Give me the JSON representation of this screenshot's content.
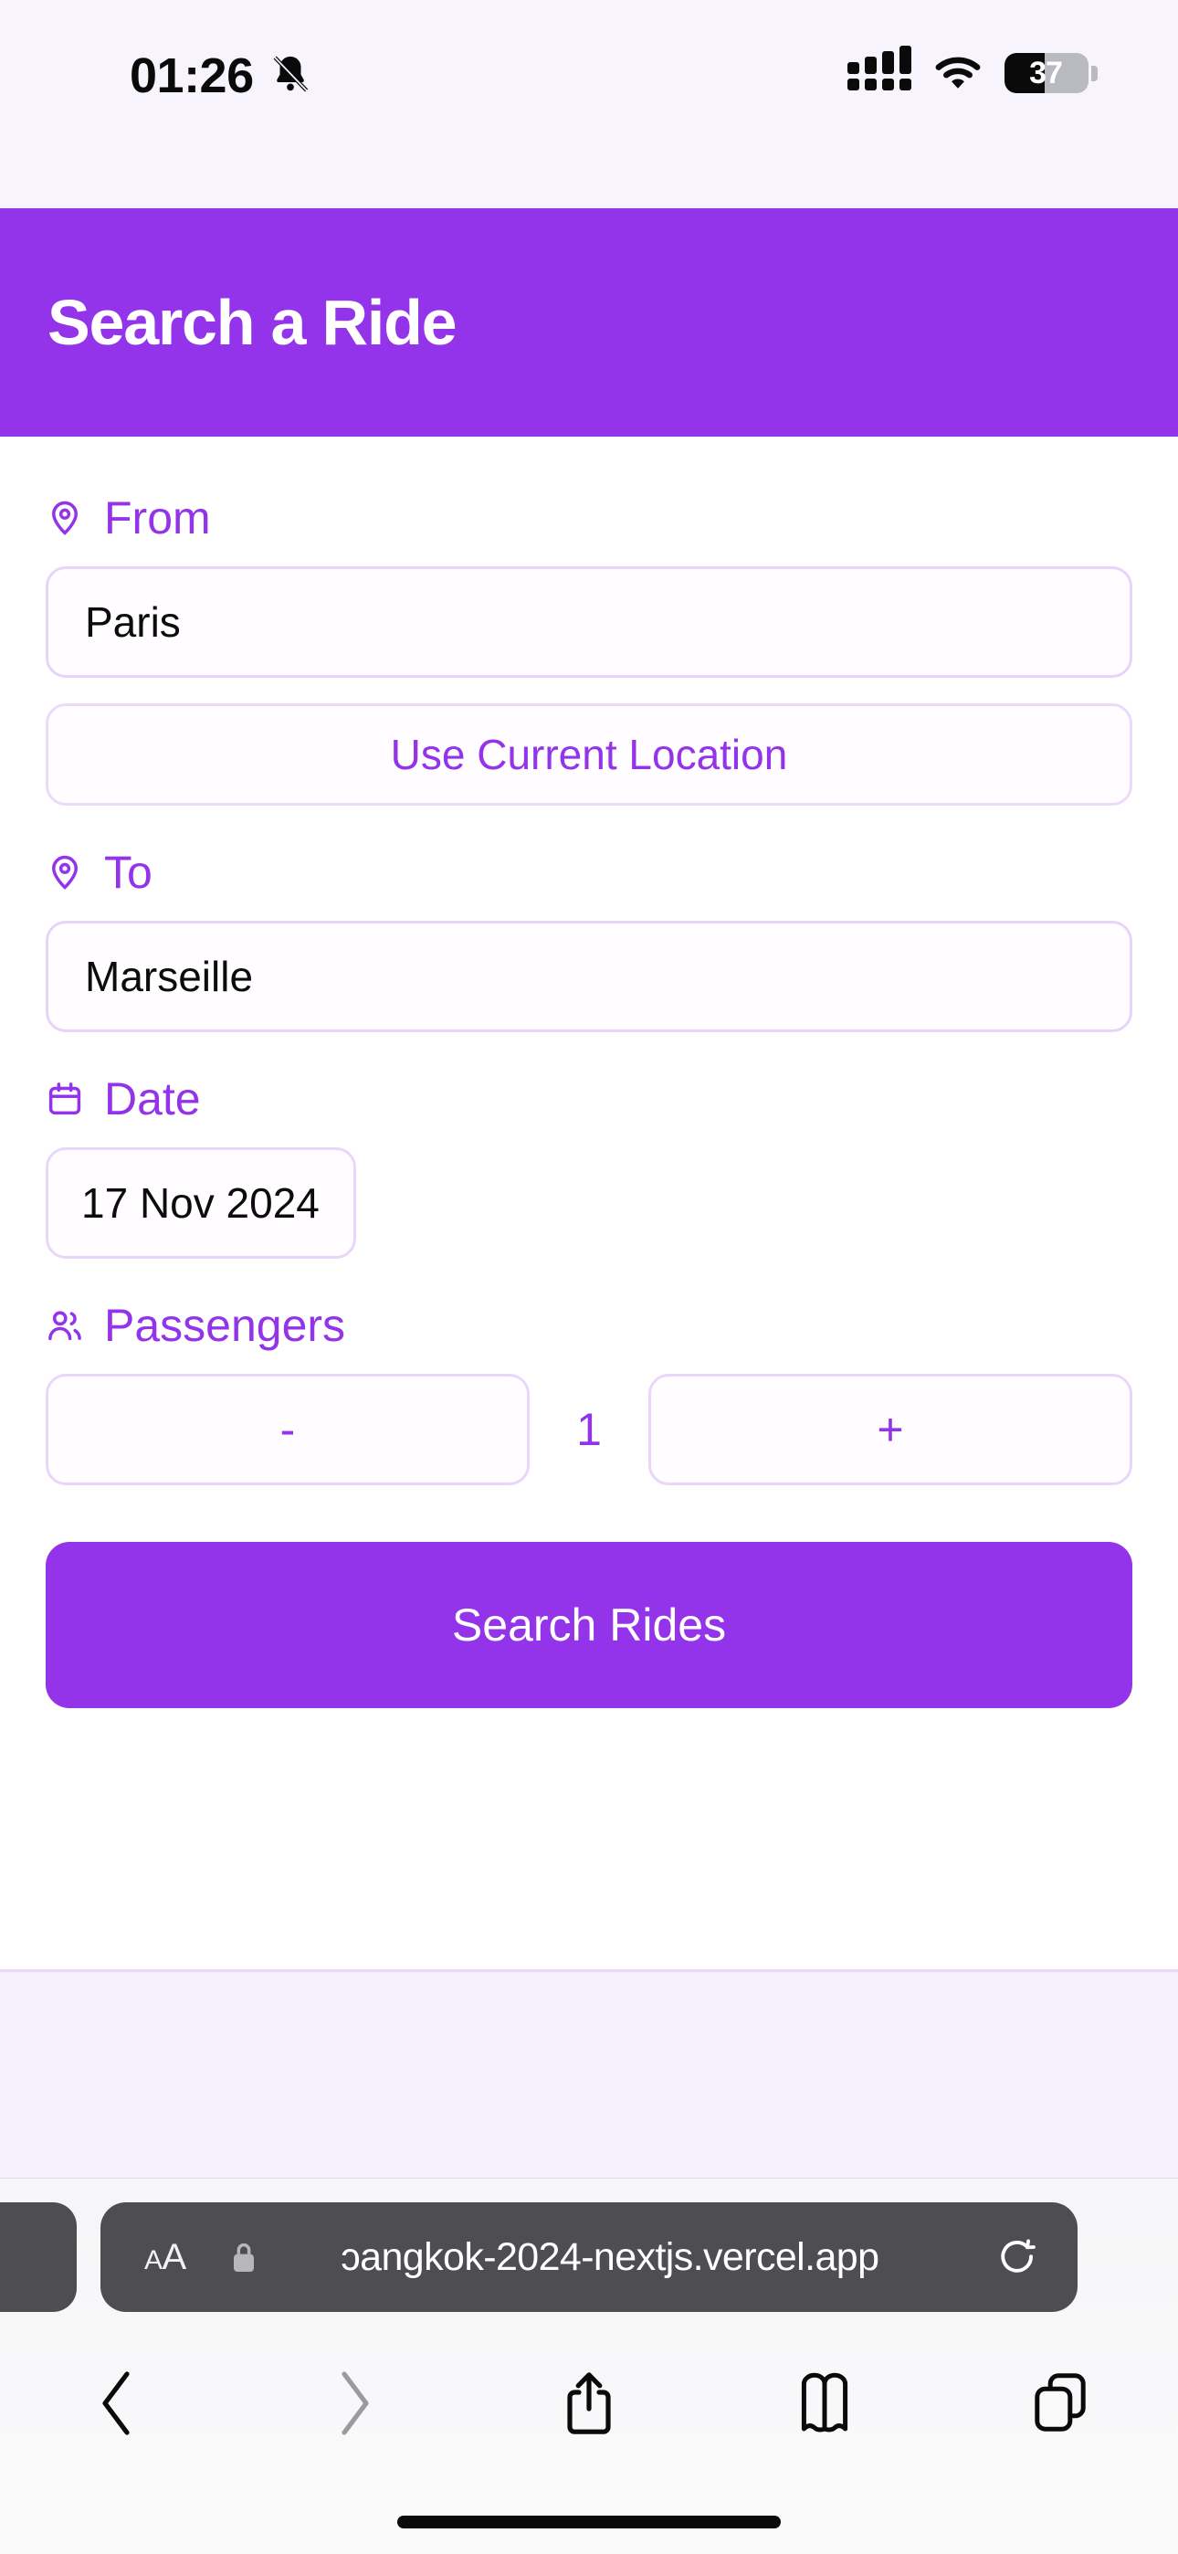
{
  "status_bar": {
    "time": "01:26",
    "silent_icon": "bell-slash-icon",
    "cellular_icon": "cellular-signal-icon",
    "wifi_icon": "wifi-icon",
    "battery_percent": "37",
    "battery_fill_pct": 48,
    "background_color": "#f8f4fe"
  },
  "header": {
    "title": "Search a Ride",
    "background_color": "#9333ea",
    "text_color": "#ffffff"
  },
  "form": {
    "accent_color": "#9333ea",
    "border_color": "#e7d4fb",
    "from": {
      "label": "From",
      "icon": "map-pin-icon",
      "value": "Paris",
      "placeholder": "From"
    },
    "use_current_location": {
      "label": "Use Current Location"
    },
    "to": {
      "label": "To",
      "icon": "map-pin-icon",
      "value": "Marseille",
      "placeholder": "To"
    },
    "date": {
      "label": "Date",
      "icon": "calendar-icon",
      "value": "17 Nov 2024"
    },
    "passengers": {
      "label": "Passengers",
      "icon": "users-icon",
      "decrement_label": "-",
      "count": "1",
      "increment_label": "+"
    },
    "submit": {
      "label": "Search Rides"
    }
  },
  "browser": {
    "text_size_label": "AA",
    "lock_icon": "lock-icon",
    "url": "ɔangkok-2024-nextjs.vercel.app",
    "reload_icon": "reload-icon",
    "toolbar": [
      {
        "name": "back-button",
        "icon": "chevron-left-icon",
        "enabled": true
      },
      {
        "name": "forward-button",
        "icon": "chevron-right-icon",
        "enabled": false
      },
      {
        "name": "share-button",
        "icon": "share-icon",
        "enabled": true
      },
      {
        "name": "bookmarks-button",
        "icon": "book-icon",
        "enabled": true
      },
      {
        "name": "tabs-button",
        "icon": "tabs-icon",
        "enabled": true
      }
    ],
    "pill_color": "#4d4d52"
  }
}
